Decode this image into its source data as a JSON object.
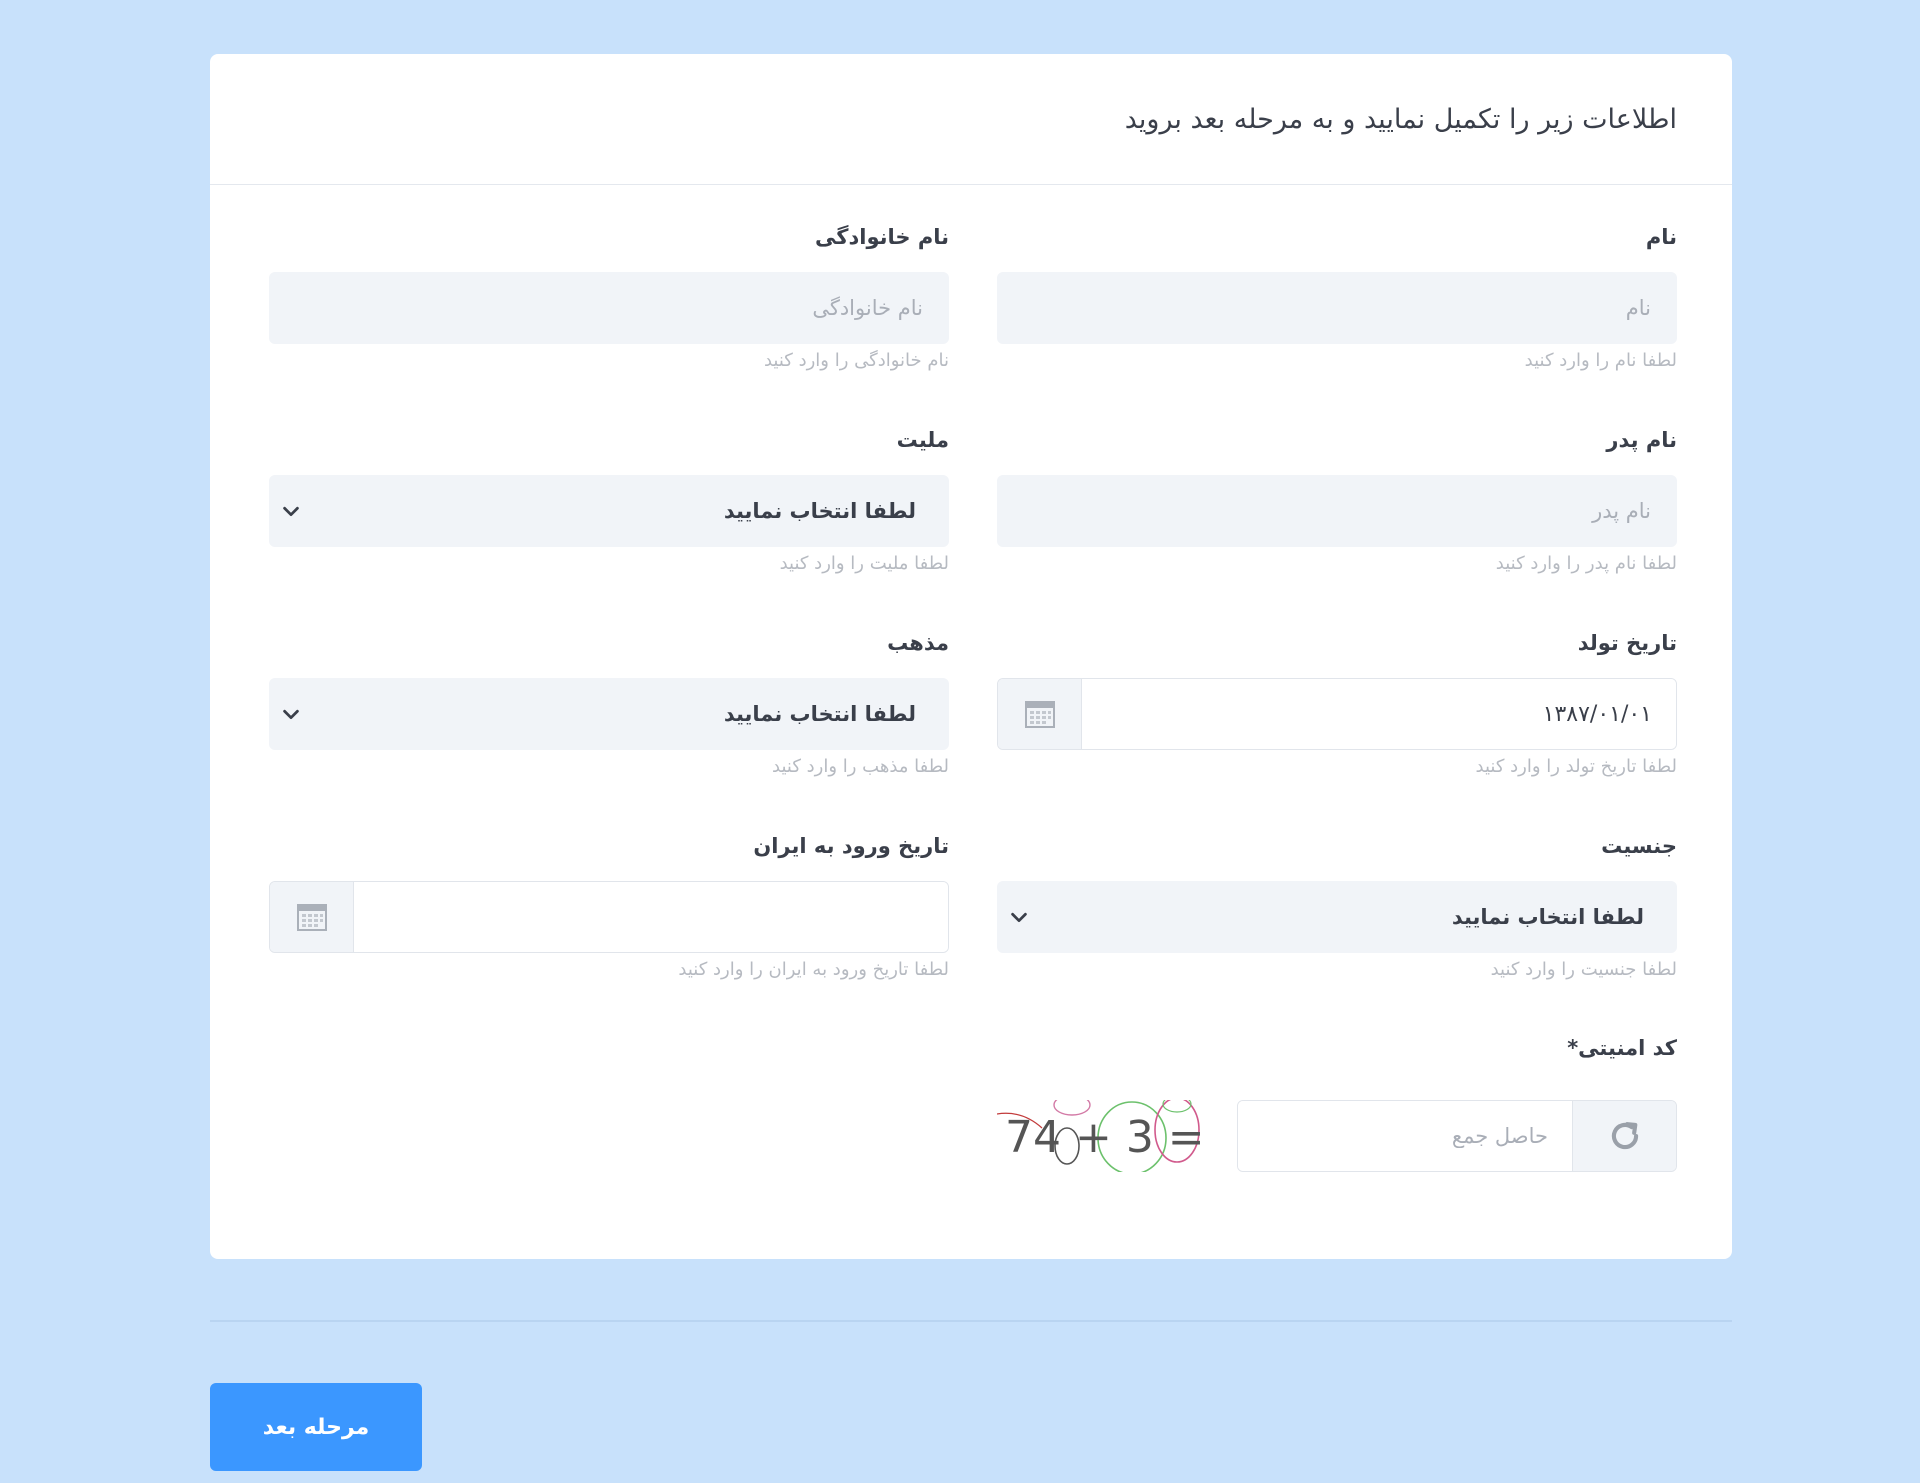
{
  "header": {
    "title": "اطلاعات زیر را تکمیل نمایید و به مرحله بعد بروید"
  },
  "fields": {
    "first_name": {
      "label": "نام",
      "placeholder": "نام",
      "help": "لطفا نام را وارد کنید"
    },
    "last_name": {
      "label": "نام خانوادگی",
      "placeholder": "نام خانوادگی",
      "help": "نام خانوادگی را وارد کنید"
    },
    "father_name": {
      "label": "نام پدر",
      "placeholder": "نام پدر",
      "help": "لطفا نام پدر را وارد کنید"
    },
    "nationality": {
      "label": "ملیت",
      "selected": "لطفا انتخاب نمایید",
      "help": "لطفا ملیت را وارد کنید"
    },
    "birth_date": {
      "label": "تاریخ تولد",
      "value": "۱۳۸۷/۰۱/۰۱",
      "help": "لطفا تاریخ تولد را وارد کنید",
      "icon": "calendar-icon"
    },
    "religion": {
      "label": "مذهب",
      "selected": "لطفا انتخاب نمایید",
      "help": "لطفا مذهب را وارد کنید"
    },
    "gender": {
      "label": "جنسیت",
      "selected": "لطفا انتخاب نمایید",
      "help": "لطفا جنسیت را وارد کنید"
    },
    "entry_date": {
      "label": "تاریخ ورود به ایران",
      "value": "",
      "help": "لطفا تاریخ ورود به ایران را وارد کنید",
      "icon": "calendar-icon"
    },
    "captcha": {
      "label": "کد امنیتی",
      "required_mark": "*",
      "placeholder": "حاصل جمع",
      "image_text": "74 + 3 = ?",
      "refresh_icon": "refresh-icon"
    }
  },
  "footer": {
    "next_label": "مرحله بعد"
  },
  "colors": {
    "background": "#c8e1fb",
    "card": "#ffffff",
    "input_bg": "#f1f4f8",
    "primary_button": "#3b97ff"
  }
}
